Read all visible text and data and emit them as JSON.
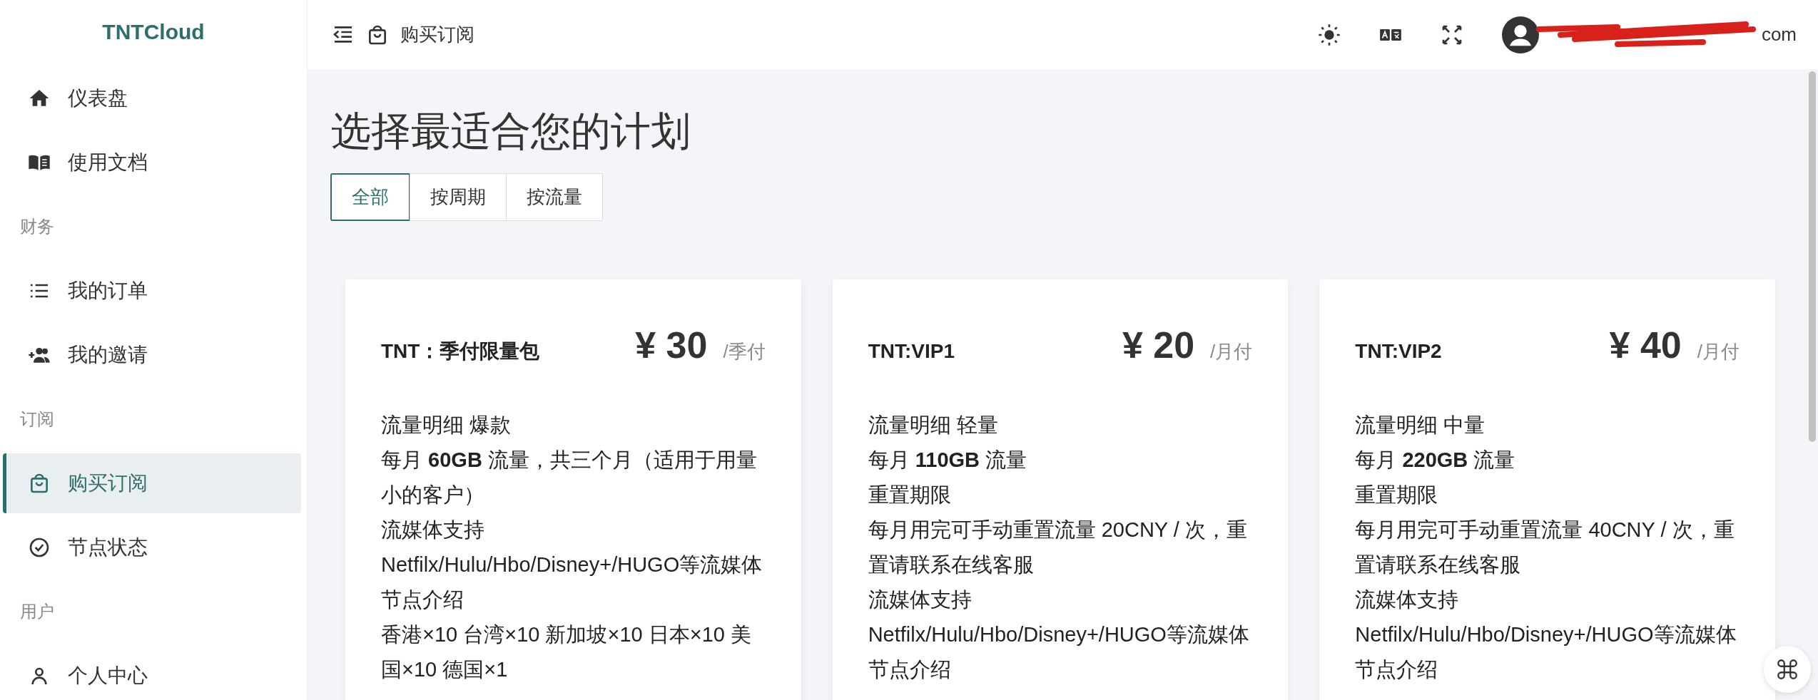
{
  "brand": "TNTCloud",
  "sidebar": {
    "items": [
      {
        "kind": "item",
        "label": "仪表盘",
        "selected": false
      },
      {
        "kind": "item",
        "label": "使用文档",
        "selected": false
      },
      {
        "kind": "section",
        "label": "财务"
      },
      {
        "kind": "item",
        "label": "我的订单",
        "selected": false
      },
      {
        "kind": "item",
        "label": "我的邀请",
        "selected": false
      },
      {
        "kind": "section",
        "label": "订阅"
      },
      {
        "kind": "item",
        "label": "购买订阅",
        "selected": true
      },
      {
        "kind": "item",
        "label": "节点状态",
        "selected": false
      },
      {
        "kind": "section",
        "label": "用户"
      },
      {
        "kind": "item",
        "label": "个人中心",
        "selected": false
      }
    ]
  },
  "header": {
    "breadcrumb": "购买订阅",
    "user_email_visible": "com"
  },
  "page_title": "选择最适合您的计划",
  "tabs": [
    {
      "label": "全部",
      "selected": true
    },
    {
      "label": "按周期",
      "selected": false
    },
    {
      "label": "按流量",
      "selected": false
    }
  ],
  "plans": [
    {
      "name": "TNT：季付限量包",
      "price": "¥ 30",
      "period": "/季付",
      "lines": [
        "流量明细 爆款",
        "每月 **60GB** 流量，共三个月（适用于用量小的客户）",
        "流媒体支持",
        "Netfilx/Hulu/Hbo/Disney+/HUGO等流媒体",
        "节点介绍",
        "香港×10 台湾×10 新加坡×10 日本×10 美国×10 德国×1"
      ]
    },
    {
      "name": "TNT:VIP1",
      "price": "¥ 20",
      "period": "/月付",
      "lines": [
        "流量明细 轻量",
        "每月 **110GB** 流量",
        "重置期限",
        "每月用完可手动重置流量 20CNY / 次，重置请联系在线客服",
        "流媒体支持",
        "Netfilx/Hulu/Hbo/Disney+/HUGO等流媒体",
        "节点介绍"
      ]
    },
    {
      "name": "TNT:VIP2",
      "price": "¥ 40",
      "period": "/月付",
      "lines": [
        "流量明细 中量",
        "每月 **220GB** 流量",
        "重置期限",
        "每月用完可手动重置流量 40CNY / 次，重置请联系在线客服",
        "流媒体支持",
        "Netfilx/Hulu/Hbo/Disney+/HUGO等流媒体",
        "节点介绍"
      ]
    }
  ]
}
